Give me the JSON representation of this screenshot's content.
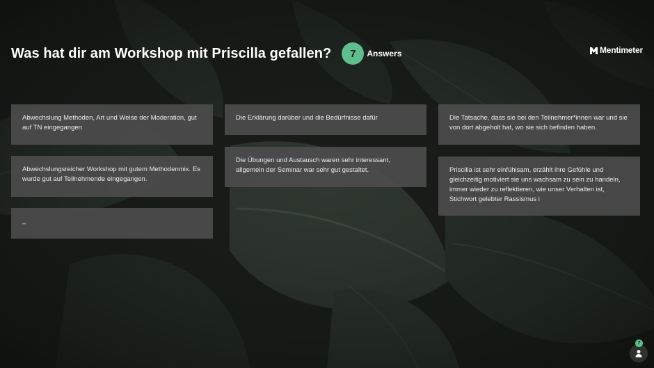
{
  "question": {
    "title": "Was hat dir am Workshop mit Priscilla gefallen?",
    "answer_count": "7",
    "answer_label": "Answers"
  },
  "brand": {
    "name": "Mentimeter",
    "logo_icon": "mentimeter-logo-icon"
  },
  "colors": {
    "accent": "#5fbd8e",
    "card_background": "#4b4b4b",
    "background": "#151815"
  },
  "answers": [
    {
      "text": "Abwechslung Methoden, Art und Weise der Moderation, gut auf TN eingegangen"
    },
    {
      "text": "Abwechslungsreicher Workshop mit gutem Methodenmix. Es wurde gut auf Teilnehmende eingegangen."
    },
    {
      "text": "–"
    },
    {
      "text": "Die Erklärung darüber und die Bedürfnisse dafür"
    },
    {
      "text": "Die Übungen und Austausch waren sehr interessant, allgemein der Seminar war sehr gut gestaltet."
    },
    {
      "text": "Die Tatsache, dass sie bei den Teilnehmer*innen war und sie von dort abgeholt hat, wo sie sich befinden haben."
    },
    {
      "text": "Priscilla ist sehr einfühlsam, erzählt ihre Gefühle und gleichzeitig motiviert sie uns wachsam zu sein zu handeln, immer wieder zu reflektieren, wie unser Verhalten ist, Stichwort gelebter Rassismus i"
    }
  ],
  "footer": {
    "participant_count": "7",
    "participant_icon": "person-icon"
  }
}
